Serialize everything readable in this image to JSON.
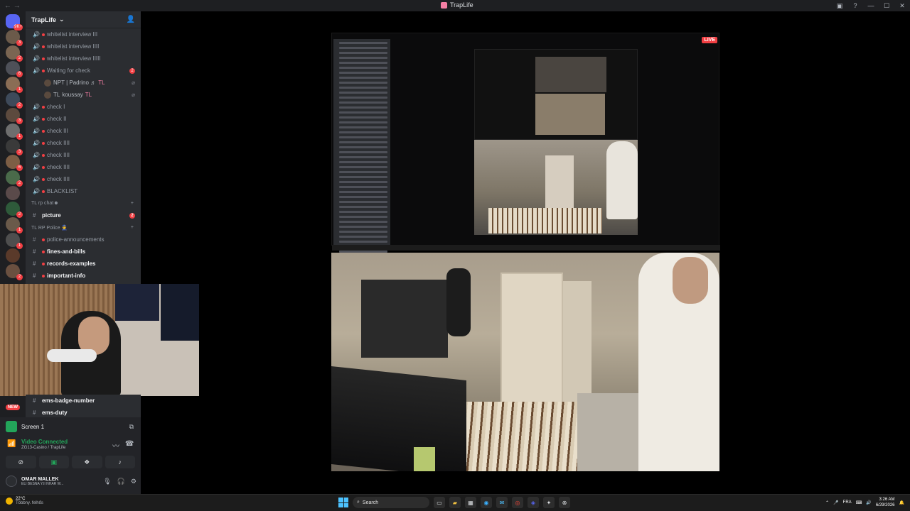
{
  "window": {
    "title": "TrapLife",
    "nav": "← →",
    "controls": [
      "▣",
      "?",
      "—",
      "☐",
      "✕"
    ]
  },
  "servers": [
    {
      "type": "dm",
      "badge": "9K+"
    },
    {
      "badge": "3"
    },
    {
      "badge": "2"
    },
    {
      "badge": "6"
    },
    {
      "badge": "1"
    },
    {
      "badge": "2"
    },
    {
      "badge": "3"
    },
    {
      "badge": "1"
    },
    {
      "badge": "3"
    },
    {
      "badge": "6"
    },
    {
      "badge": "2"
    },
    {
      "badge": ""
    },
    {
      "badge": "2"
    },
    {
      "badge": "1"
    },
    {
      "badge": "1"
    },
    {
      "badge": ""
    },
    {
      "badge": "2"
    }
  ],
  "guild": {
    "name": "TrapLife",
    "chevron": "⌄"
  },
  "channels": [
    {
      "kind": "voice",
      "name": "whitelist interview III"
    },
    {
      "kind": "voice",
      "name": "whitelist interview IIII"
    },
    {
      "kind": "voice",
      "name": "whitelist interview IIIII"
    },
    {
      "kind": "voice",
      "name": "Waiting for check",
      "badge": "2"
    },
    {
      "kind": "user",
      "name": "NPT | Padrino ♬",
      "tag": "TL"
    },
    {
      "kind": "user",
      "name": "TL",
      "tag": "koussay",
      "tag2": "TL"
    },
    {
      "kind": "voice",
      "name": "check I"
    },
    {
      "kind": "voice",
      "name": "check II"
    },
    {
      "kind": "voice",
      "name": "check III"
    },
    {
      "kind": "voice",
      "name": "check IIII"
    },
    {
      "kind": "voice",
      "name": "check IIII"
    },
    {
      "kind": "voice",
      "name": "check IIII"
    },
    {
      "kind": "voice",
      "name": "check IIII"
    },
    {
      "kind": "voice",
      "name": "BLACKLIST"
    }
  ],
  "category_rp": {
    "name": "TL rp chat☻"
  },
  "channel_picture": {
    "name": "picture",
    "badge": "2"
  },
  "category_police": {
    "name": "TL RP Police 👮"
  },
  "channels_police": [
    {
      "name": "police-announcements",
      "bold": false
    },
    {
      "name": "fines-and-bills",
      "bold": true
    },
    {
      "name": "records-examples",
      "bold": true
    },
    {
      "name": "important-info",
      "bold": true
    }
  ],
  "channels_ems": [
    {
      "name": "ems-badge-number"
    },
    {
      "name": "ems-duty"
    }
  ],
  "new_badge": "NEW",
  "screen": {
    "label": "Screen 1"
  },
  "voice": {
    "status": "Video Connected",
    "sub": "ZG13-Casino / TrapLife"
  },
  "user": {
    "name": "OMAR MALLEK",
    "status": "ELI BESNA Y.II NHAR W..."
  },
  "stream": {
    "live": "LIVE"
  },
  "taskbar": {
    "weather_temp": "22°C",
    "weather_desc": "Többny. felhős",
    "search": "Search",
    "lang": "FRA",
    "time": "3:26 AM",
    "date": "6/29/2026"
  }
}
